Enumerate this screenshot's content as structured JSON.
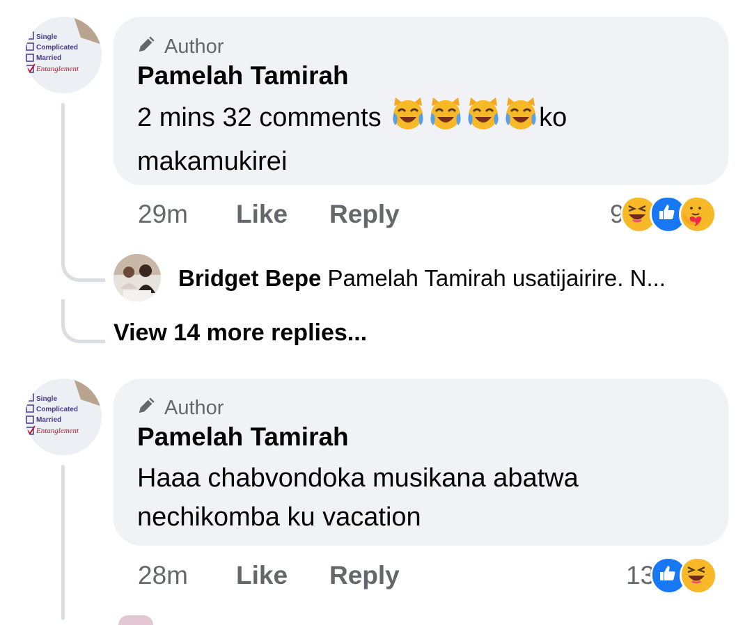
{
  "comments": [
    {
      "author_badge": "Author",
      "name": "Pamelah Tamirah",
      "text_line1": "2 mins 32 comments",
      "text_after_emoji": "ko",
      "text_line2": "makamukirei",
      "time": "29m",
      "like_label": "Like",
      "reply_label": "Reply",
      "reaction_count": "9",
      "reactions": [
        "laugh-icon",
        "like-icon",
        "care-icon"
      ]
    },
    {
      "author_badge": "Author",
      "name": "Pamelah Tamirah",
      "text_line1": "Haaa chabvondoka musikana abatwa",
      "text_line2": "nechikomba ku vacation",
      "time": "28m",
      "like_label": "Like",
      "reply_label": "Reply",
      "reaction_count": "13",
      "reactions": [
        "like-icon",
        "laugh-icon"
      ]
    }
  ],
  "reply_preview": {
    "name": "Bridget Bepe",
    "text": "Pamelah Tamirah usatijairire. N..."
  },
  "view_more_label": "View 14 more replies...",
  "avatar_text": {
    "line1": "Single",
    "line2": "Complicated",
    "line3": "Married",
    "line4": "Entanglement"
  },
  "colors": {
    "bubble": "#f0f2f5",
    "meta": "#65676b",
    "like_blue": "#1877f2",
    "reaction_yellow": "#f7b928"
  }
}
